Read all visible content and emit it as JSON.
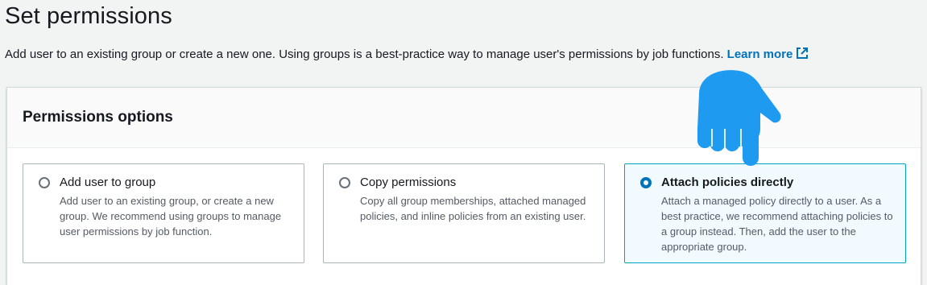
{
  "page": {
    "title": "Set permissions",
    "description": "Add user to an existing group or create a new one. Using groups is a best-practice way to manage user's permissions by job functions.",
    "learn_more": "Learn more"
  },
  "permissions": {
    "title": "Permissions options",
    "options": [
      {
        "label": "Add user to group",
        "description": "Add user to an existing group, or create a new group. We recommend using groups to manage user permissions by job function.",
        "selected": false
      },
      {
        "label": "Copy permissions",
        "description": "Copy all group memberships, attached managed policies, and inline policies from an existing user.",
        "selected": false
      },
      {
        "label": "Attach policies directly",
        "description": "Attach a managed policy directly to a user. As a best practice, we recommend attaching policies to a group instead. Then, add the user to the appropriate group.",
        "selected": true
      }
    ]
  },
  "colors": {
    "accent": "#0073bb",
    "pointer": "#1e9bf0",
    "selected_tile_bg": "#f1faff"
  },
  "icons": {
    "external_link": "external-link-icon",
    "pointer": "hand-pointer-icon"
  }
}
